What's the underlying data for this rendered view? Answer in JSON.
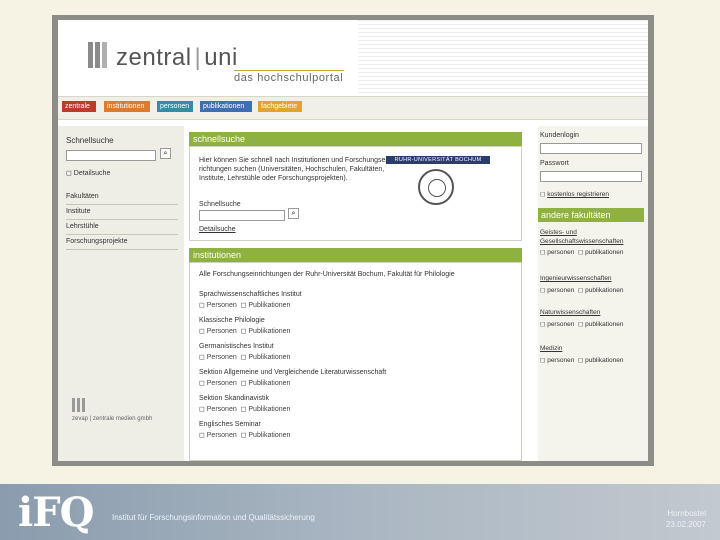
{
  "header": {
    "logo_main": "zentral",
    "logo_sep": "|",
    "logo_uni": "uni",
    "logo_sub": "das hochschulportal"
  },
  "nav": {
    "tabs": [
      {
        "label": "zentrale",
        "color": "#c0392b"
      },
      {
        "label": "institutionen",
        "color": "#e07a2b"
      },
      {
        "label": "personen",
        "color": "#2f8fa4"
      },
      {
        "label": "publikationen",
        "color": "#3f6fb0"
      },
      {
        "label": "fachgebiete",
        "color": "#e0a52b"
      }
    ]
  },
  "left": {
    "title": "Schnellsuche",
    "search_glyph": "⌕",
    "detail": "Detailsuche",
    "items": [
      "Fakultäten",
      "Institute",
      "Lehrstühle",
      "Forschungsprojekte"
    ],
    "footer_logo": "zevap",
    "footer_text": "zentrale medien gmbh"
  },
  "main": {
    "schnellsuche": {
      "header": "schnellsuche",
      "text1": "Hier können Sie schnell nach Institutionen und Forschungsein-",
      "text2": "richtungen suchen (Universitäten, Hochschulen, Fakultäten,",
      "text3": "Institute, Lehrstühle oder Forschungsprojekten).",
      "ruhr": "RUHR-UNIVERSITÄT BOCHUM",
      "field_label": "Schnellsuche",
      "detail": "Detailsuche"
    },
    "institutionen": {
      "header": "institutionen",
      "intro": "Alle Forschungseinrichtungen der Ruhr-Universität Bochum, Fakultät für Philologie",
      "link_personen": "Personen",
      "link_publikationen": "Publikationen",
      "items": [
        "Sprachwissenschaftliches Institut",
        "Klassische Philologie",
        "Germanistisches Institut",
        "Sektion Allgemeine und Vergleichende Literaturwissenschaft",
        "Sektion Skandinavistik",
        "Englisches Seminar"
      ]
    }
  },
  "right": {
    "login_label": "Kundenlogin",
    "password_label": "Passwort",
    "register": "kostenlos registrieren",
    "other_header": "andere fakultäten",
    "opt_personen": "personen",
    "opt_publikationen": "publikationen",
    "faculties": [
      "Geistes- und Gesellschaftswissenschaften",
      "Ingenieurwissenschaften",
      "Naturwissenschaften",
      "Medizin"
    ]
  },
  "footer": {
    "logo": "iFQ",
    "tagline": "Institut für Forschungsinformation und Qualitätssicherung",
    "author": "Hornbostel",
    "date": "23.02.2007"
  }
}
